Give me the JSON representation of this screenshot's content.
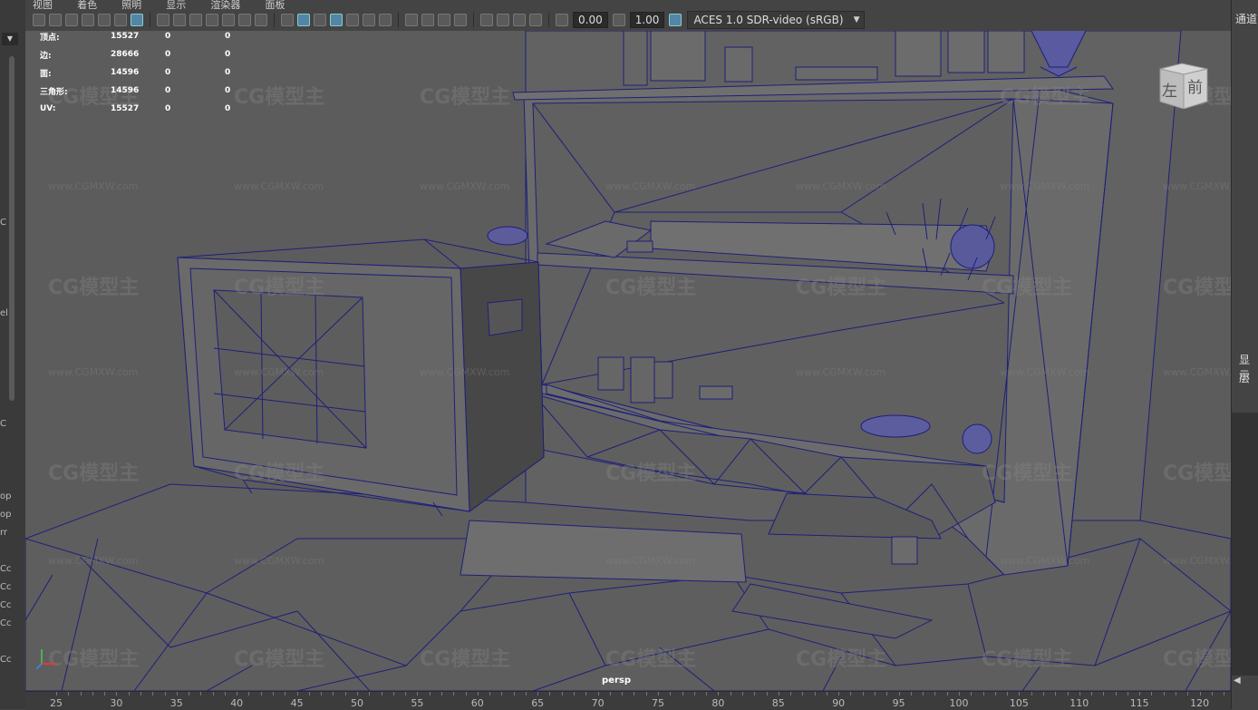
{
  "menu": [
    "视图",
    "着色",
    "照明",
    "显示",
    "渲染器",
    "面板"
  ],
  "toolbar": {
    "exposure_value": "0.00",
    "gamma_value": "1.00",
    "color_space": "ACES 1.0 SDR-video (sRGB)"
  },
  "hud": {
    "rows": [
      {
        "label": "顶点:",
        "v1": "15527",
        "v2": "0",
        "v3": "0"
      },
      {
        "label": "边:",
        "v1": "28666",
        "v2": "0",
        "v3": "0"
      },
      {
        "label": "面:",
        "v1": "14596",
        "v2": "0",
        "v3": "0"
      },
      {
        "label": "三角形:",
        "v1": "14596",
        "v2": "0",
        "v3": "0"
      },
      {
        "label": "UV:",
        "v1": "15527",
        "v2": "0",
        "v3": "0"
      }
    ]
  },
  "viewcube": {
    "left": "左",
    "front": "前"
  },
  "camera_label": "persp",
  "watermark": {
    "logo": "CG模型主",
    "url": "www.CGMXW.com"
  },
  "right_panel": {
    "channel_label": "通道",
    "display_label": "显示",
    "layer_label": "层"
  },
  "left_strip_fragments": [
    "C",
    "el",
    "C",
    "op",
    "op",
    "rr",
    "Cc",
    "Cc",
    "Cc",
    "Cc",
    "Cc"
  ],
  "timeline": {
    "ticks": [
      "25",
      "30",
      "35",
      "40",
      "45",
      "50",
      "55",
      "60",
      "65",
      "70",
      "75",
      "80",
      "85",
      "90",
      "95",
      "100",
      "105",
      "110",
      "115",
      "120"
    ]
  },
  "colors": {
    "viewport_bg": "#5c5c5c",
    "wireframe": "#1e1f7a",
    "ui_bg": "#444444"
  }
}
